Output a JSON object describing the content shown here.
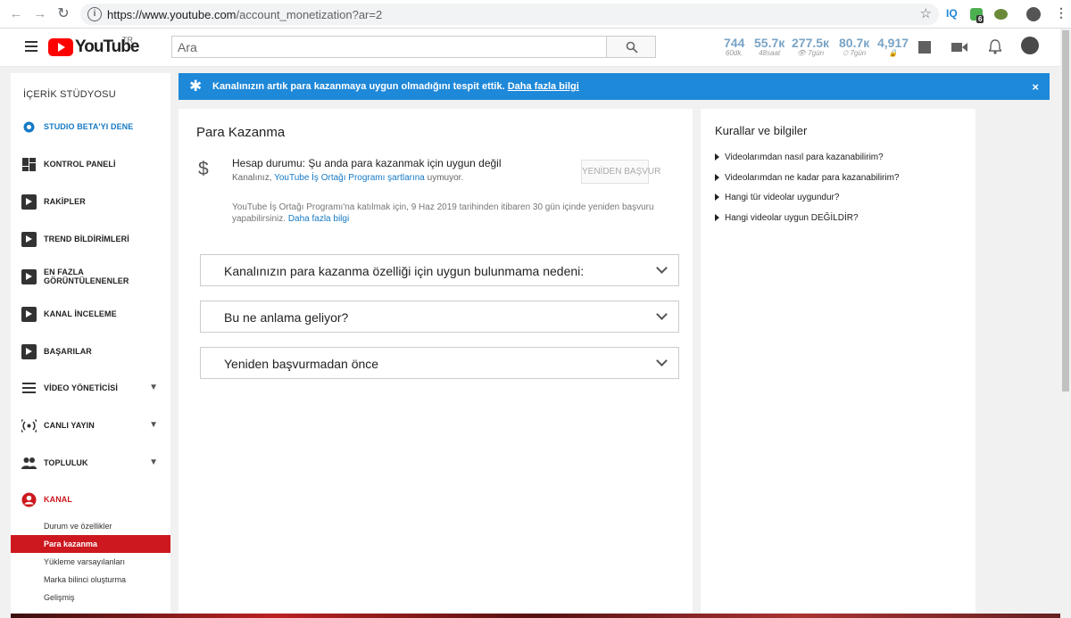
{
  "browser": {
    "url_host": "https://www.youtube.com",
    "url_path": "/account_monetization?ar=2",
    "ext_iq": "IQ",
    "ext_badge": "6"
  },
  "header": {
    "logo_text": "YouTube",
    "logo_region": "TR",
    "search_placeholder": "Ara",
    "stats": [
      {
        "value": "744",
        "sub": "60dk."
      },
      {
        "value": "55.7к",
        "sub": "48saat"
      },
      {
        "value": "277.5к",
        "sub": "👁 7gün"
      },
      {
        "value": "80.7к",
        "sub": "⏱ 7gün"
      },
      {
        "value": "4,917",
        "sub": "🔒"
      }
    ]
  },
  "sidebar": {
    "title": "İÇERİK STÜDYOSU",
    "items": [
      {
        "label": "STUDIO BETA'YI DENE"
      },
      {
        "label": "KONTROL PANELİ"
      },
      {
        "label": "RAKİPLER"
      },
      {
        "label": "TREND BİLDİRİMLERİ"
      },
      {
        "label": "EN FAZLA GÖRÜNTÜLENENLER"
      },
      {
        "label": "KANAL İNCELEME"
      },
      {
        "label": "BAŞARILAR"
      },
      {
        "label": "VİDEO YÖNETİCİSİ"
      },
      {
        "label": "CANLI YAYIN"
      },
      {
        "label": "TOPLULUK"
      },
      {
        "label": "KANAL"
      }
    ],
    "subitems": [
      {
        "label": "Durum ve özellikler"
      },
      {
        "label": "Para kazanma"
      },
      {
        "label": "Yükleme varsayılanları"
      },
      {
        "label": "Marka bilinci oluşturma"
      },
      {
        "label": "Gelişmiş"
      }
    ]
  },
  "banner": {
    "text": "Kanalınızın artık para kazanmaya uygun olmadığını tespit ettik.",
    "link": "Daha fazla bilgi",
    "close": "×"
  },
  "main": {
    "title": "Para Kazanma",
    "status": "Hesap durumu: Şu anda para kazanmak için uygun değil",
    "status_sub_prefix": "Kanalınız, ",
    "status_sub_link": "YouTube İş Ortağı Programı şartlarına",
    "status_sub_suffix": " uymuyor.",
    "reapply": "YENİDEN BAŞVUR",
    "note": "YouTube İş Ortağı Programı'na katılmak için, 9 Haz 2019 tarihinden itibaren 30 gün içinde yeniden başvuru yapabilirsiniz.",
    "note_link": "Daha fazla bilgi",
    "accordions": [
      {
        "label": "Kanalınızın para kazanma özelliği için uygun bulunmama nedeni:"
      },
      {
        "label": "Bu ne anlama geliyor?"
      },
      {
        "label": "Yeniden başvurmadan önce"
      }
    ]
  },
  "rules": {
    "title": "Kurallar ve bilgiler",
    "items": [
      {
        "label": "Videolarımdan nasıl para kazanabilirim?"
      },
      {
        "label": "Videolarımdan ne kadar para kazanabilirim?"
      },
      {
        "label": "Hangi tür videolar uygundur?"
      },
      {
        "label": "Hangi videolar uygun DEĞİLDİR?"
      }
    ]
  }
}
